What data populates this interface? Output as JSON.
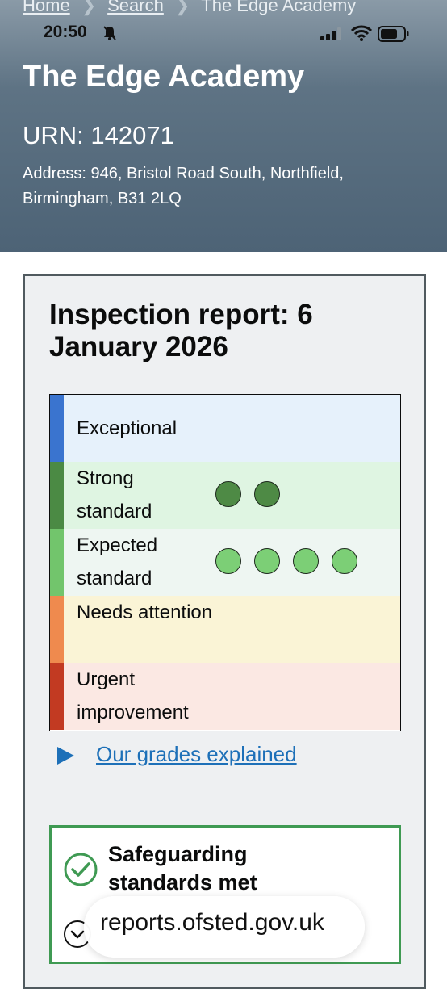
{
  "breadcrumb": {
    "items": [
      "Home",
      "Search",
      "The Edge Academy"
    ]
  },
  "status_bar": {
    "time": "20:50"
  },
  "header": {
    "school_name": "The Edge Academy",
    "urn": "URN: 142071",
    "address": "Address: 946, Bristol Road South, Northfield, Birmingham, B31 2LQ"
  },
  "report": {
    "title": "Inspection report: 6 January 2026",
    "grades": [
      {
        "label": "Exceptional",
        "count": 0,
        "bar_color": "#3a74cf",
        "bg_color": "#e6f1fb",
        "dot_color": ""
      },
      {
        "label": "Strong standard",
        "count": 2,
        "bar_color": "#4b8a44",
        "bg_color": "#dff5e2",
        "dot_color": "#4e8a45"
      },
      {
        "label": "Expected standard",
        "count": 4,
        "bar_color": "#72c56c",
        "bg_color": "#eef6f2",
        "dot_color": "#7ccf76"
      },
      {
        "label": "Needs attention",
        "count": 0,
        "bar_color": "#ef8a4e",
        "bg_color": "#faf4d6",
        "dot_color": ""
      },
      {
        "label": "Urgent improvement",
        "count": 0,
        "bar_color": "#c23a22",
        "bg_color": "#fbe8e3",
        "dot_color": ""
      }
    ],
    "grades_link": "Our grades explained",
    "safeguarding": "Safeguarding standards met"
  },
  "url_bar": {
    "domain": "reports.ofsted.gov.uk"
  },
  "colors": {
    "link": "#1d70b8",
    "safeguarding_border": "#3f9a53",
    "panel_bg": "#eef0f2"
  }
}
